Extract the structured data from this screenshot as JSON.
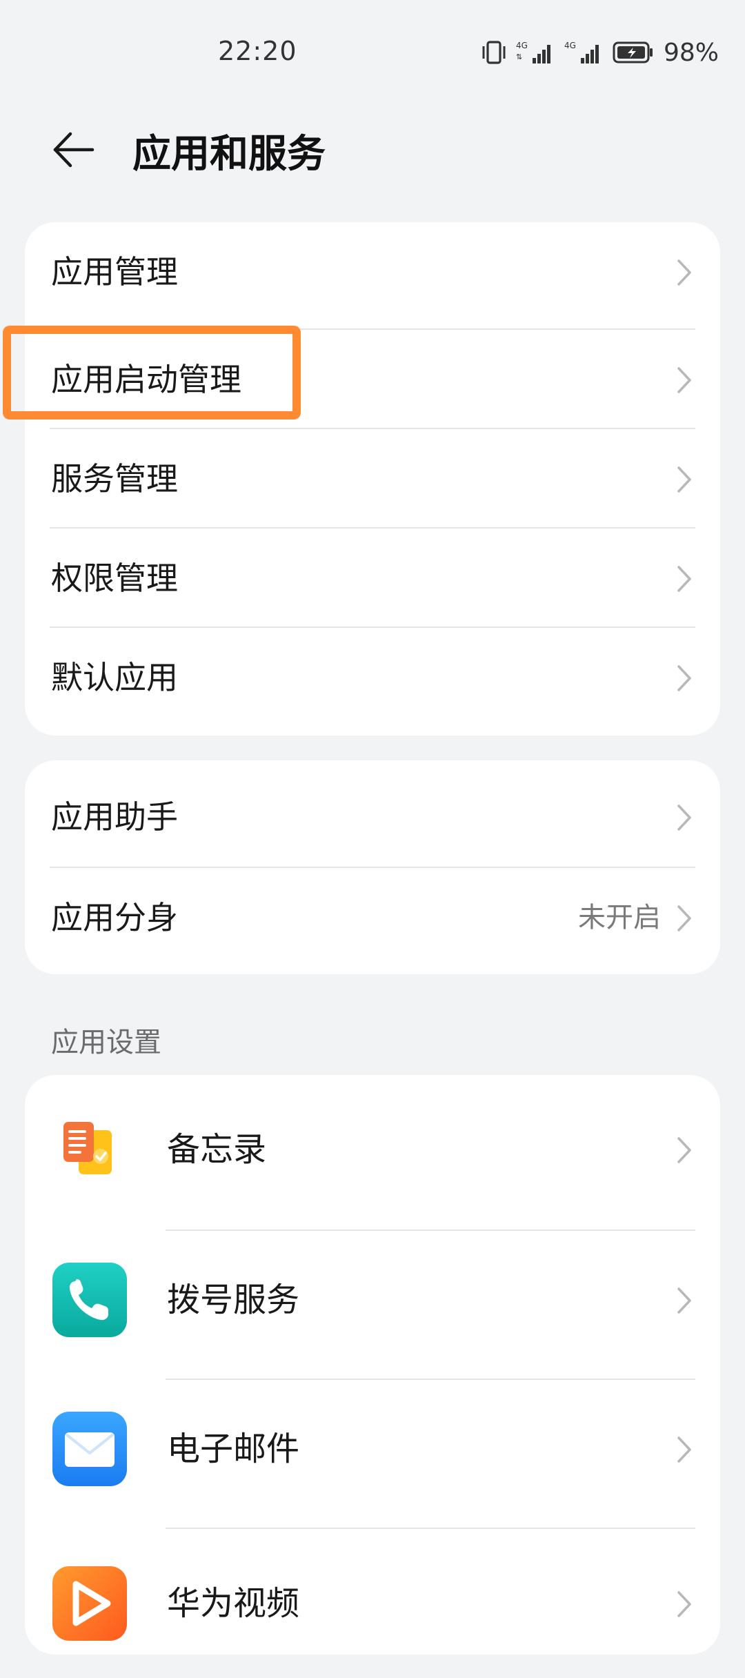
{
  "status_bar": {
    "time": "22:20",
    "battery_text": "98%",
    "icons": [
      "vibrate-icon",
      "signal-4g-icon",
      "signal-4g-icon",
      "battery-charging-icon"
    ],
    "network_label": "4G"
  },
  "header": {
    "title": "应用和服务",
    "back_icon": "back-arrow-icon"
  },
  "group1": {
    "items": [
      {
        "label": "应用管理"
      },
      {
        "label": "应用启动管理"
      },
      {
        "label": "服务管理"
      },
      {
        "label": "权限管理"
      },
      {
        "label": "默认应用"
      }
    ]
  },
  "group2": {
    "items": [
      {
        "label": "应用助手",
        "value": ""
      },
      {
        "label": "应用分身",
        "value": "未开启"
      }
    ]
  },
  "app_settings": {
    "section_title": "应用设置",
    "items": [
      {
        "label": "备忘录",
        "icon": "memo-icon"
      },
      {
        "label": "拨号服务",
        "icon": "phone-icon"
      },
      {
        "label": "电子邮件",
        "icon": "email-icon"
      },
      {
        "label": "华为视频",
        "icon": "video-icon"
      }
    ]
  },
  "highlight": {
    "color": "#ff8a32",
    "target": "应用启动管理"
  },
  "colors": {
    "background": "#f1f3f5",
    "card": "#ffffff",
    "secondary_text": "#7a7a7a"
  }
}
